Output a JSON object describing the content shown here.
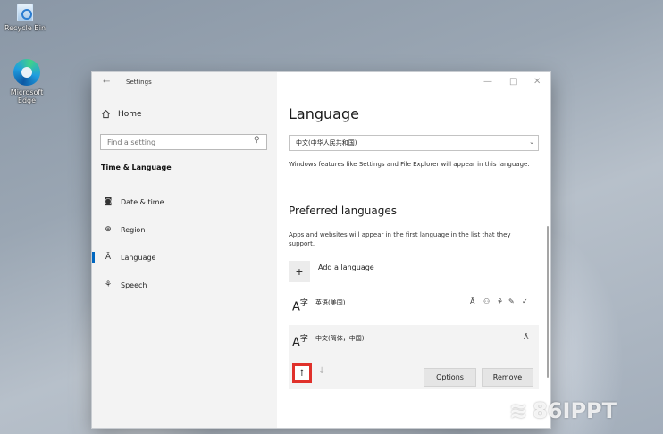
{
  "desktop": {
    "icons": [
      {
        "label": "Recycle Bin",
        "icon": "recycle-bin-icon"
      },
      {
        "label": "Microsoft Edge",
        "icon": "edge-icon"
      }
    ],
    "watermark": "86IPPT"
  },
  "window": {
    "title": "Settings",
    "controls": {
      "minimize": "—",
      "maximize": "□",
      "close": "✕"
    },
    "accent": "#0067c0"
  },
  "sidebar": {
    "home_label": "Home",
    "search_placeholder": "Find a setting",
    "section_title": "Time & Language",
    "items": [
      {
        "label": "Date & time",
        "icon": "calendar-clock-icon"
      },
      {
        "label": "Region",
        "icon": "globe-icon"
      },
      {
        "label": "Language",
        "icon": "language-icon",
        "active": true
      },
      {
        "label": "Speech",
        "icon": "microphone-icon"
      }
    ]
  },
  "main": {
    "title": "Language",
    "display_language": "中文(中华人民共和国)",
    "display_language_desc": "Windows features like Settings and File Explorer will appear in this language.",
    "preferred_title": "Preferred languages",
    "preferred_desc": "Apps and websites will appear in the first language in the list that they support.",
    "add_language_label": "Add a language",
    "languages": [
      {
        "name": "英语(美国)",
        "features": [
          "display-language-icon",
          "speech-icon",
          "microphone-icon",
          "handwriting-icon",
          "spelling-icon"
        ]
      },
      {
        "name": "中文(简体，中国)",
        "features": [
          "display-language-icon"
        ],
        "selected": true
      }
    ],
    "options_label": "Options",
    "remove_label": "Remove",
    "highlight_color": "#e0312b"
  }
}
